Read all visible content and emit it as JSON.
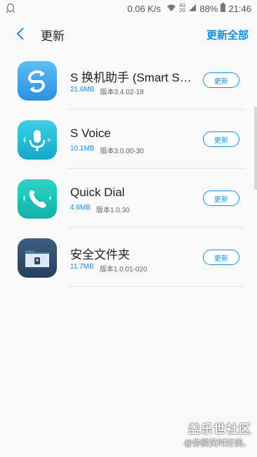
{
  "status_bar": {
    "speed": "0.06 K/s",
    "network_top": "4G",
    "network_bottom": "2G",
    "battery": "88%",
    "time": "21:46"
  },
  "header": {
    "title": "更新",
    "update_all": "更新全部"
  },
  "apps": [
    {
      "name": "S 换机助手 (Smart Switch)",
      "size": "21.6MB",
      "version": "版本3.4.02-18",
      "button": "更新",
      "icon": "smart-switch-icon"
    },
    {
      "name": "S Voice",
      "size": "10.1MB",
      "version": "版本3.0.00-30",
      "button": "更新",
      "icon": "s-voice-icon"
    },
    {
      "name": "Quick Dial",
      "size": "4.6MB",
      "version": "版本1.0.30",
      "button": "更新",
      "icon": "quick-dial-icon"
    },
    {
      "name": "安全文件夹",
      "size": "11.7MB",
      "version": "版本1.0.01-020",
      "button": "更新",
      "icon": "secure-folder-icon"
    }
  ],
  "watermark": {
    "line1": "盖乐世社区",
    "line2": "@你微笑时好美、"
  }
}
